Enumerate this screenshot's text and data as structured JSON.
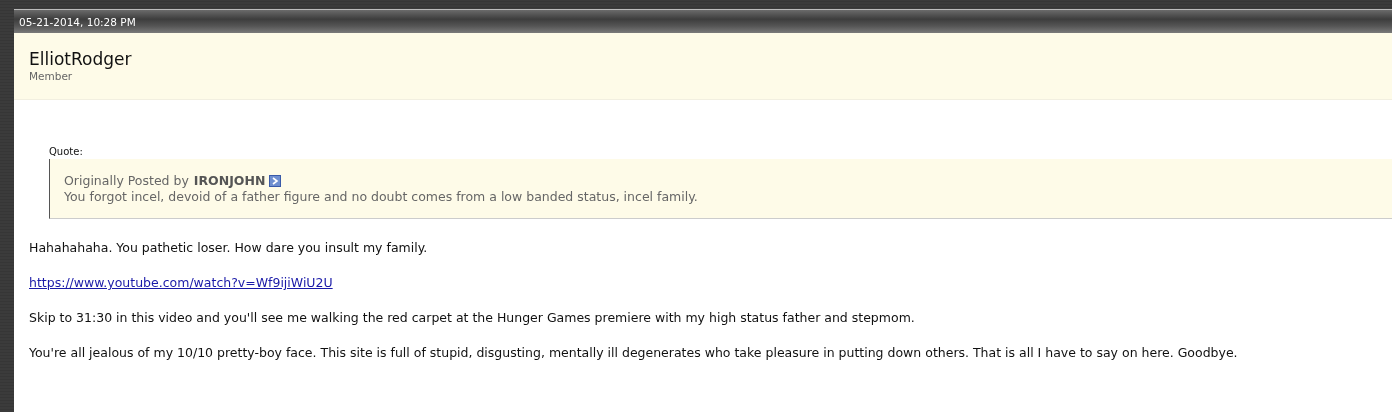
{
  "post": {
    "date": "05-21-2014, 10:28 PM",
    "username": "ElliotRodger",
    "user_title": "Member",
    "quote": {
      "label": "Quote:",
      "prefix": "Originally Posted by",
      "author": "IRONJOHN",
      "text": "You forgot incel, devoid of a father figure and no doubt comes from a low banded status, incel family."
    },
    "message": [
      {
        "kind": "text",
        "text": "Hahahahaha. You pathetic loser. How dare you insult my family."
      },
      {
        "kind": "link",
        "text": "https://www.youtube.com/watch?v=Wf9ijiWiU2U"
      },
      {
        "kind": "text",
        "text": "Skip to 31:30 in this video and you'll see me walking the red carpet at the Hunger Games premiere with my high status father and stepmom."
      },
      {
        "kind": "text",
        "text": "You're all jealous of my 10/10 pretty-boy face. This site is full of stupid, disgusting, mentally ill degenerates who take pleasure in putting down others. That is all I have to say on here. Goodbye."
      }
    ]
  }
}
